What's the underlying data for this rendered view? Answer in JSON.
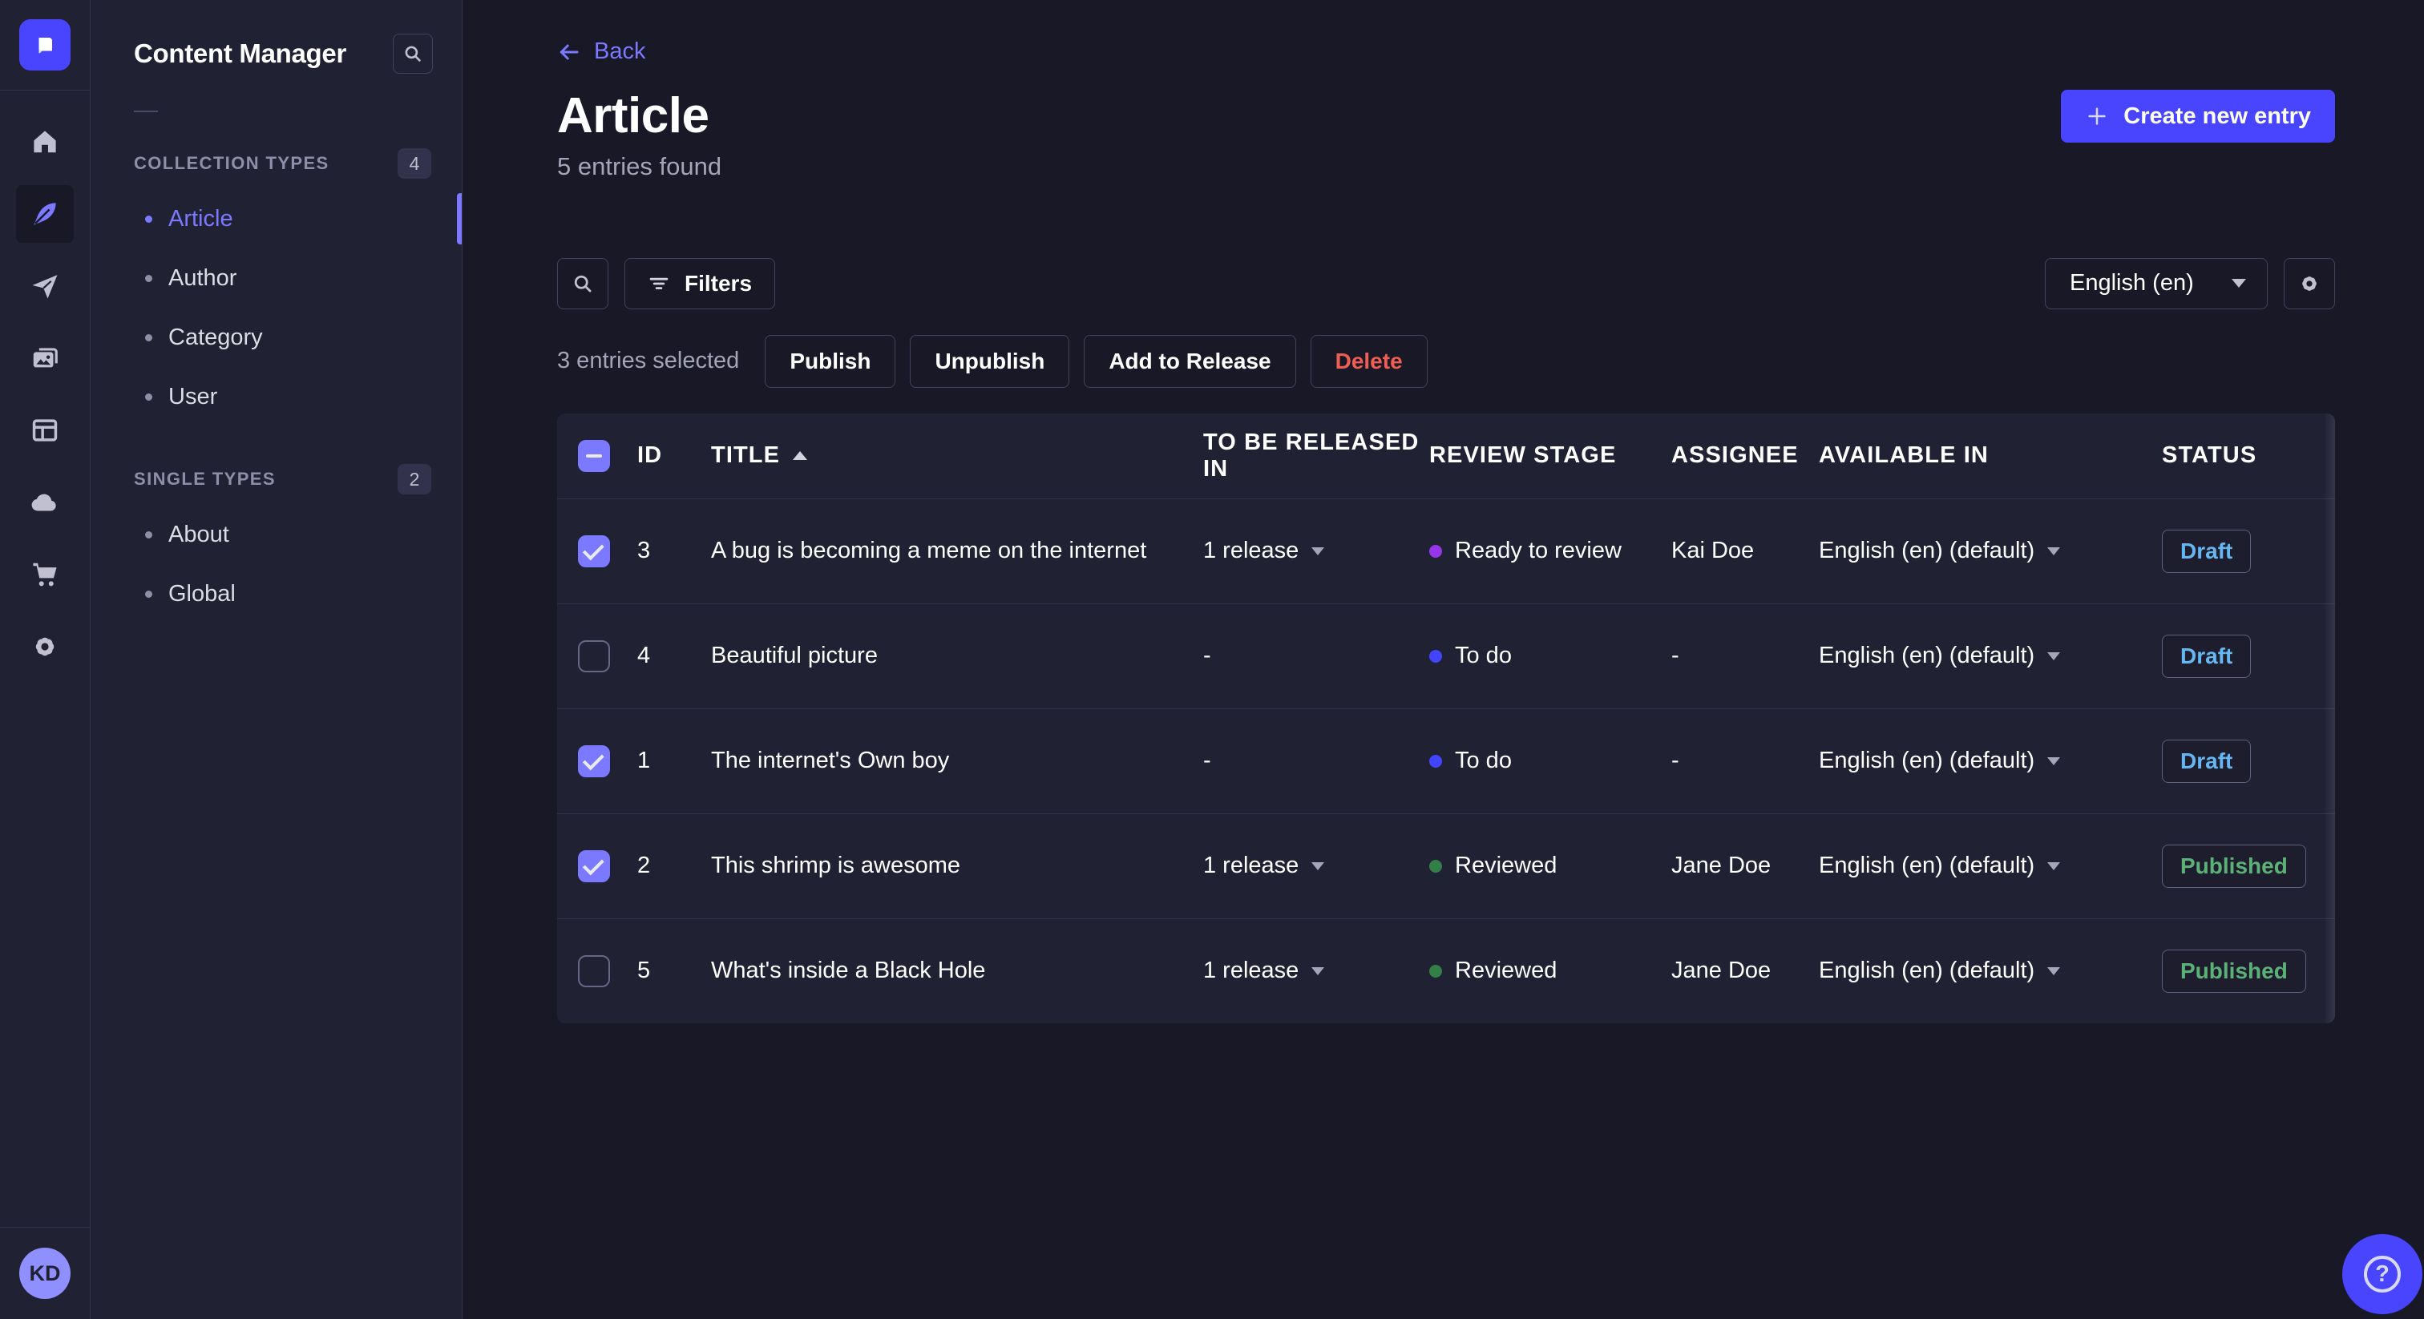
{
  "nav_rail": {
    "logo_icon": "strapi-logo",
    "items": [
      {
        "icon": "home-icon",
        "active": false
      },
      {
        "icon": "content-manager-feather-icon",
        "active": true
      },
      {
        "icon": "releases-paper-plane-icon",
        "active": false
      },
      {
        "icon": "media-library-images-icon",
        "active": false
      },
      {
        "icon": "content-type-builder-layout-icon",
        "active": false
      },
      {
        "icon": "cloud-icon",
        "active": false
      },
      {
        "icon": "marketplace-cart-icon",
        "active": false
      },
      {
        "icon": "settings-gear-icon",
        "active": false
      }
    ],
    "avatar_initials": "KD"
  },
  "sidebar": {
    "title": "Content Manager",
    "collection_types": {
      "label": "COLLECTION TYPES",
      "count": "4",
      "items": [
        {
          "label": "Article",
          "active": true
        },
        {
          "label": "Author",
          "active": false
        },
        {
          "label": "Category",
          "active": false
        },
        {
          "label": "User",
          "active": false
        }
      ]
    },
    "single_types": {
      "label": "SINGLE TYPES",
      "count": "2",
      "items": [
        {
          "label": "About",
          "active": false
        },
        {
          "label": "Global",
          "active": false
        }
      ]
    }
  },
  "header": {
    "back_label": "Back",
    "title": "Article",
    "subtitle": "5 entries found",
    "create_button_label": "Create new entry"
  },
  "toolbar": {
    "filters_label": "Filters",
    "locale_selected": "English (en)"
  },
  "selection": {
    "text": "3 entries selected",
    "publish_label": "Publish",
    "unpublish_label": "Unpublish",
    "add_to_release_label": "Add to Release",
    "delete_label": "Delete"
  },
  "table": {
    "headers": {
      "id": "ID",
      "title": "TITLE",
      "released": "TO BE RELEASED IN",
      "review": "REVIEW STAGE",
      "assignee": "ASSIGNEE",
      "available": "AVAILABLE IN",
      "status": "STATUS"
    },
    "rows": [
      {
        "checked": true,
        "id": "3",
        "title": "A bug is becoming a meme on the internet",
        "released": "1 release",
        "review": "Ready to review",
        "review_color": "#9736e8",
        "assignee": "Kai Doe",
        "available": "English (en) (default)",
        "status": "Draft",
        "status_color": "#66b7f1"
      },
      {
        "checked": false,
        "id": "4",
        "title": "Beautiful picture",
        "released": "-",
        "review": "To do",
        "review_color": "#4245ff",
        "assignee": "-",
        "available": "English (en) (default)",
        "status": "Draft",
        "status_color": "#66b7f1"
      },
      {
        "checked": true,
        "id": "1",
        "title": "The internet's Own boy",
        "released": "-",
        "review": "To do",
        "review_color": "#4245ff",
        "assignee": "-",
        "available": "English (en) (default)",
        "status": "Draft",
        "status_color": "#66b7f1"
      },
      {
        "checked": true,
        "id": "2",
        "title": "This shrimp is awesome",
        "released": "1 release",
        "review": "Reviewed",
        "review_color": "#328048",
        "assignee": "Jane Doe",
        "available": "English (en) (default)",
        "status": "Published",
        "status_color": "#5cb176"
      },
      {
        "checked": false,
        "id": "5",
        "title": "What's inside a Black Hole",
        "released": "1 release",
        "review": "Reviewed",
        "review_color": "#328048",
        "assignee": "Jane Doe",
        "available": "English (en) (default)",
        "status": "Published",
        "status_color": "#5cb176"
      }
    ]
  },
  "help": {
    "glyph": "?"
  },
  "colors": {
    "primary": "#4945ff",
    "primary_light": "#7b79ff",
    "app_background": "#181826",
    "panel_background": "#212134",
    "border": "#32324d",
    "draft": "#66b7f1",
    "published": "#5cb176",
    "danger": "#ee5e52",
    "stage_todo": "#4245ff",
    "stage_ready_to_review": "#9736e8",
    "stage_reviewed": "#328048"
  }
}
